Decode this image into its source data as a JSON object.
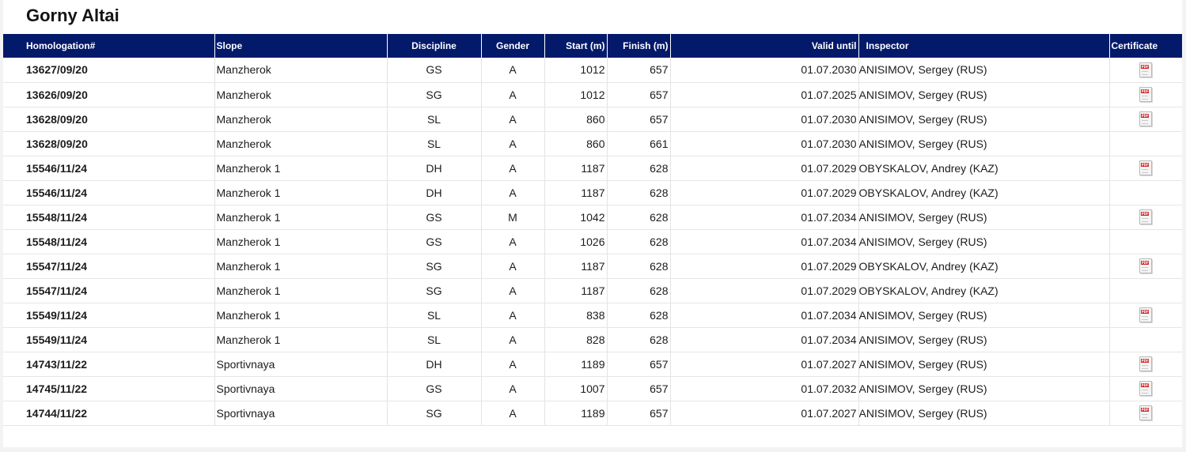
{
  "page": {
    "title": "Gorny Altai"
  },
  "colors": {
    "header_bg": "#031a6b",
    "header_text": "#ffffff",
    "pdf_red": "#d21f1f"
  },
  "table": {
    "headers": {
      "homologation": "Homologation#",
      "slope": "Slope",
      "discipline": "Discipline",
      "gender": "Gender",
      "start": "Start (m)",
      "finish": "Finish (m)",
      "valid_until": "Valid until",
      "inspector": "Inspector",
      "certificate": "Certificate"
    },
    "rows": [
      {
        "homologation": "13627/09/20",
        "slope": "Manzherok",
        "discipline": "GS",
        "gender": "A",
        "start": "1012",
        "finish": "657",
        "valid_until": "01.07.2030",
        "inspector": "ANISIMOV, Sergey (RUS)",
        "certificate": true
      },
      {
        "homologation": "13626/09/20",
        "slope": "Manzherok",
        "discipline": "SG",
        "gender": "A",
        "start": "1012",
        "finish": "657",
        "valid_until": "01.07.2025",
        "inspector": "ANISIMOV, Sergey (RUS)",
        "certificate": true
      },
      {
        "homologation": "13628/09/20",
        "slope": "Manzherok",
        "discipline": "SL",
        "gender": "A",
        "start": "860",
        "finish": "657",
        "valid_until": "01.07.2030",
        "inspector": "ANISIMOV, Sergey (RUS)",
        "certificate": true
      },
      {
        "homologation": "13628/09/20",
        "slope": "Manzherok",
        "discipline": "SL",
        "gender": "A",
        "start": "860",
        "finish": "661",
        "valid_until": "01.07.2030",
        "inspector": "ANISIMOV, Sergey (RUS)",
        "certificate": false
      },
      {
        "homologation": "15546/11/24",
        "slope": "Manzherok 1",
        "discipline": "DH",
        "gender": "A",
        "start": "1187",
        "finish": "628",
        "valid_until": "01.07.2029",
        "inspector": "OBYSKALOV, Andrey (KAZ)",
        "certificate": true
      },
      {
        "homologation": "15546/11/24",
        "slope": "Manzherok 1",
        "discipline": "DH",
        "gender": "A",
        "start": "1187",
        "finish": "628",
        "valid_until": "01.07.2029",
        "inspector": "OBYSKALOV, Andrey (KAZ)",
        "certificate": false
      },
      {
        "homologation": "15548/11/24",
        "slope": "Manzherok 1",
        "discipline": "GS",
        "gender": "M",
        "start": "1042",
        "finish": "628",
        "valid_until": "01.07.2034",
        "inspector": "ANISIMOV, Sergey (RUS)",
        "certificate": true
      },
      {
        "homologation": "15548/11/24",
        "slope": "Manzherok 1",
        "discipline": "GS",
        "gender": "A",
        "start": "1026",
        "finish": "628",
        "valid_until": "01.07.2034",
        "inspector": "ANISIMOV, Sergey (RUS)",
        "certificate": false
      },
      {
        "homologation": "15547/11/24",
        "slope": "Manzherok 1",
        "discipline": "SG",
        "gender": "A",
        "start": "1187",
        "finish": "628",
        "valid_until": "01.07.2029",
        "inspector": "OBYSKALOV, Andrey (KAZ)",
        "certificate": true
      },
      {
        "homologation": "15547/11/24",
        "slope": "Manzherok 1",
        "discipline": "SG",
        "gender": "A",
        "start": "1187",
        "finish": "628",
        "valid_until": "01.07.2029",
        "inspector": "OBYSKALOV, Andrey (KAZ)",
        "certificate": false
      },
      {
        "homologation": "15549/11/24",
        "slope": "Manzherok 1",
        "discipline": "SL",
        "gender": "A",
        "start": "838",
        "finish": "628",
        "valid_until": "01.07.2034",
        "inspector": "ANISIMOV, Sergey (RUS)",
        "certificate": true
      },
      {
        "homologation": "15549/11/24",
        "slope": "Manzherok 1",
        "discipline": "SL",
        "gender": "A",
        "start": "828",
        "finish": "628",
        "valid_until": "01.07.2034",
        "inspector": "ANISIMOV, Sergey (RUS)",
        "certificate": false
      },
      {
        "homologation": "14743/11/22",
        "slope": "Sportivnaya",
        "discipline": "DH",
        "gender": "A",
        "start": "1189",
        "finish": "657",
        "valid_until": "01.07.2027",
        "inspector": "ANISIMOV, Sergey (RUS)",
        "certificate": true
      },
      {
        "homologation": "14745/11/22",
        "slope": "Sportivnaya",
        "discipline": "GS",
        "gender": "A",
        "start": "1007",
        "finish": "657",
        "valid_until": "01.07.2032",
        "inspector": "ANISIMOV, Sergey (RUS)",
        "certificate": true
      },
      {
        "homologation": "14744/11/22",
        "slope": "Sportivnaya",
        "discipline": "SG",
        "gender": "A",
        "start": "1189",
        "finish": "657",
        "valid_until": "01.07.2027",
        "inspector": "ANISIMOV, Sergey (RUS)",
        "certificate": true
      }
    ]
  }
}
